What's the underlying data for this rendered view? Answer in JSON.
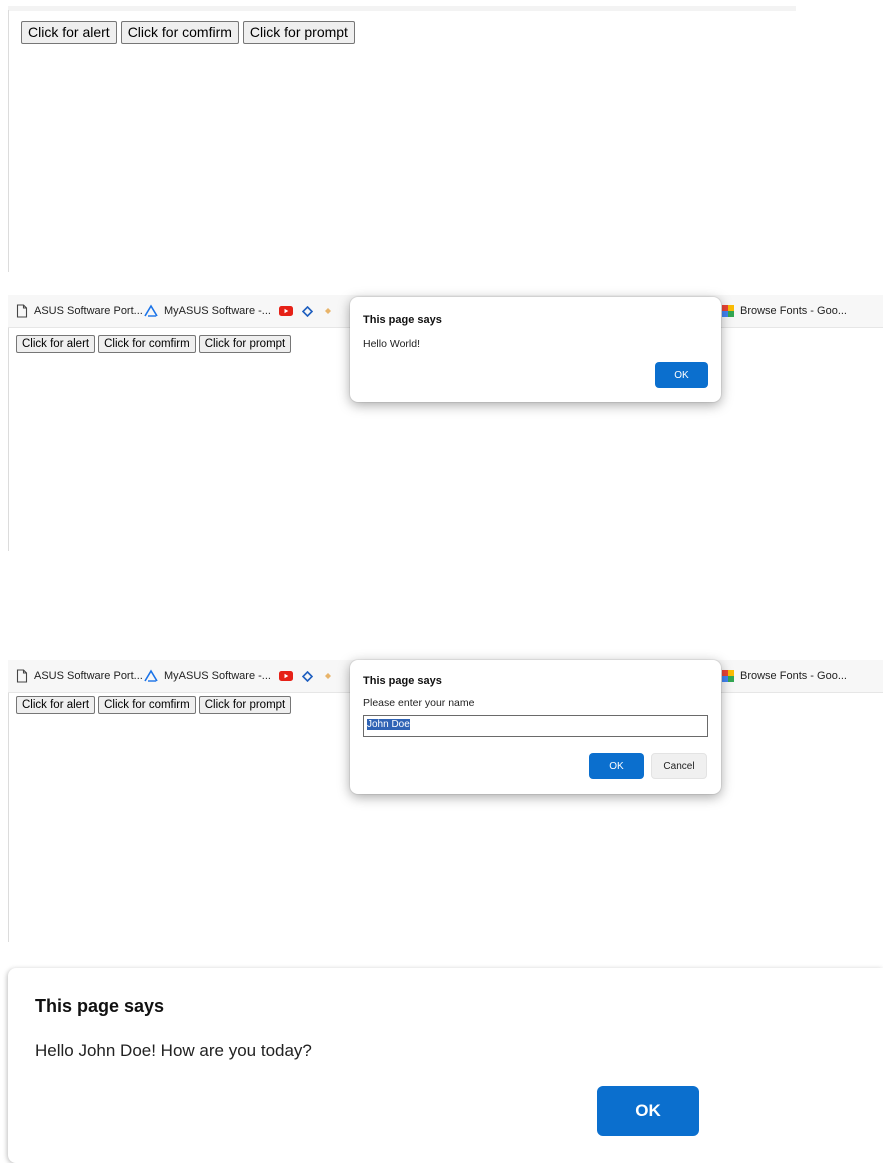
{
  "page_buttons": {
    "alert": "Click for alert",
    "confirm": "Click for comfirm",
    "prompt": "Click for prompt"
  },
  "bookmarks": [
    {
      "label": "ASUS Software Port...",
      "icon": "page-icon"
    },
    {
      "label": "MyASUS Software -...",
      "icon": "myasus-logo-icon"
    },
    {
      "label": "",
      "icon": "youtube-icon"
    },
    {
      "label": "",
      "icon": "diamond-icon"
    },
    {
      "label": "",
      "icon": "extension-icon"
    },
    {
      "label": "Browse Fonts - Goo...",
      "icon": "google-fonts-icon"
    }
  ],
  "alert_dialog": {
    "title": "This page says",
    "message": "Hello World!",
    "ok": "OK"
  },
  "prompt_dialog": {
    "title": "This page says",
    "message": "Please enter your name",
    "input_value": "John Doe",
    "ok": "OK",
    "cancel": "Cancel"
  },
  "greeting_dialog": {
    "title": "This page says",
    "message": "Hello John Doe! How are you today?",
    "ok": "OK"
  },
  "colors": {
    "accent_blue": "#0b6fce",
    "youtube_red": "#e62117",
    "selection_blue": "#2f63b5"
  }
}
